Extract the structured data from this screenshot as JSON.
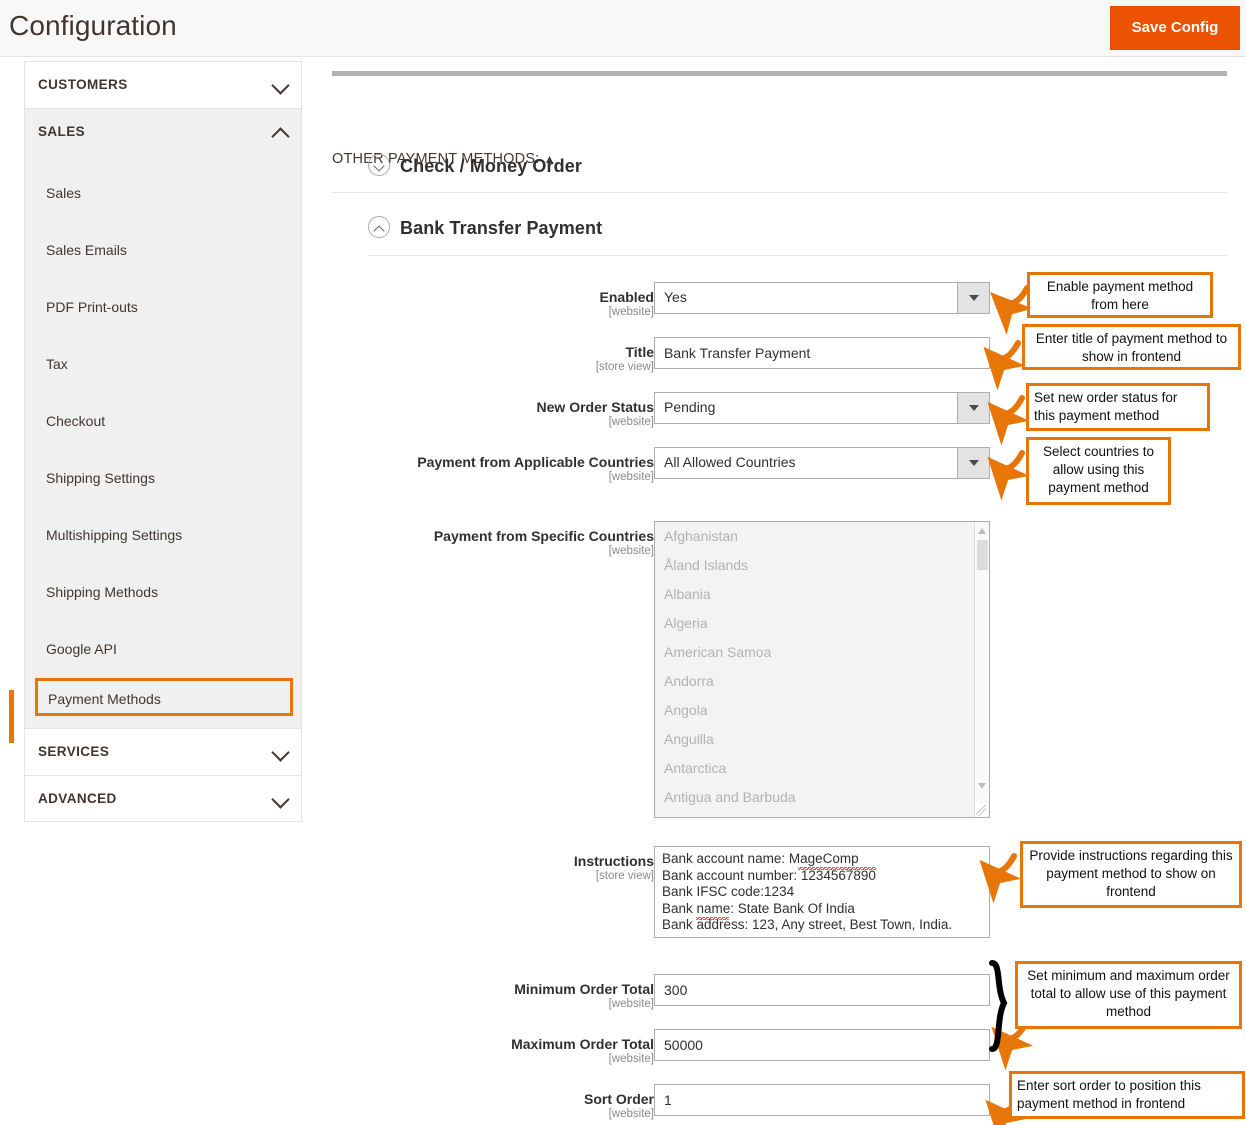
{
  "header": {
    "title": "Configuration",
    "save_label": "Save Config"
  },
  "sidebar": {
    "sections": [
      {
        "label": "CUSTOMERS",
        "expanded": false
      },
      {
        "label": "SALES",
        "expanded": true
      },
      {
        "label": "SERVICES",
        "expanded": false
      },
      {
        "label": "ADVANCED",
        "expanded": false
      }
    ],
    "sales_items": [
      "Sales",
      "Sales Emails",
      "PDF Print-outs",
      "Tax",
      "Checkout",
      "Shipping Settings",
      "Multishipping Settings",
      "Shipping Methods",
      "Google API",
      "Payment Methods"
    ],
    "highlighted_item": "Payment Methods"
  },
  "main": {
    "group_header": "OTHER PAYMENT METHODS:",
    "group_toggle_glyph": "▲",
    "accordions": [
      {
        "label": "Check / Money Order",
        "state": "collapsed",
        "icon": "chevron-down-circle-icon"
      },
      {
        "label": "Bank Transfer Payment",
        "state": "expanded",
        "icon": "chevron-up-circle-icon"
      }
    ],
    "fields": {
      "enabled": {
        "label": "Enabled",
        "scope": "[website]",
        "value": "Yes",
        "type": "select"
      },
      "title": {
        "label": "Title",
        "scope": "[store view]",
        "value": "Bank Transfer Payment",
        "type": "text"
      },
      "new_order_status": {
        "label": "New Order Status",
        "scope": "[website]",
        "value": "Pending",
        "type": "select"
      },
      "applicable_countries": {
        "label": "Payment from Applicable Countries",
        "scope": "[website]",
        "value": "All Allowed Countries",
        "type": "select"
      },
      "specific_countries": {
        "label": "Payment from Specific Countries",
        "scope": "[website]",
        "type": "multiselect",
        "disabled": true,
        "options": [
          "Afghanistan",
          "Åland Islands",
          "Albania",
          "Algeria",
          "American Samoa",
          "Andorra",
          "Angola",
          "Anguilla",
          "Antarctica",
          "Antigua and Barbuda"
        ]
      },
      "instructions": {
        "label": "Instructions",
        "scope": "[store view]",
        "type": "textarea",
        "value": "Bank account name: MageComp\nBank account number: 1234567890\nBank IFSC code:1234\nBank name: State Bank Of India\nBank address: 123, Any street, Best Town, India."
      },
      "min_order_total": {
        "label": "Minimum Order Total",
        "scope": "[website]",
        "value": "300",
        "type": "text"
      },
      "max_order_total": {
        "label": "Maximum Order Total",
        "scope": "[website]",
        "value": "50000",
        "type": "text"
      },
      "sort_order": {
        "label": "Sort Order",
        "scope": "[website]",
        "value": "1",
        "type": "text"
      }
    }
  },
  "annotations": [
    {
      "id": "enabled",
      "text": "Enable payment method from here"
    },
    {
      "id": "title",
      "text": "Enter title of payment method to show in frontend"
    },
    {
      "id": "status",
      "text": "Set new order status for this payment method"
    },
    {
      "id": "countries",
      "text": "Select countries to allow using this payment method"
    },
    {
      "id": "instructions",
      "text": "Provide instructions regarding this payment method to show on frontend"
    },
    {
      "id": "minmax",
      "text": "Set minimum and maximum order total to allow use of this payment method"
    },
    {
      "id": "sort",
      "text": "Enter sort order to position this payment method in frontend"
    }
  ],
  "colors": {
    "accent_orange": "#eb5202",
    "annotation_orange": "#e87606",
    "text_dark": "#303030",
    "muted": "#8a8a8a"
  }
}
